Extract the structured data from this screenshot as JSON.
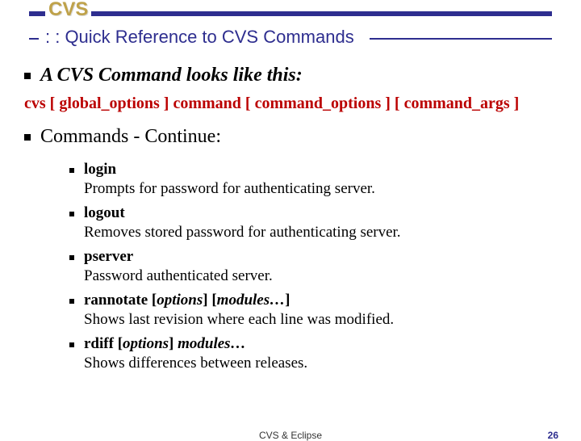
{
  "title": "CVS",
  "subtitle": ": : Quick Reference to CVS Commands",
  "section1_heading": "A CVS Command looks like this:",
  "syntax_line": "cvs [ global_options ] command [ command_options ] [ command_args ]",
  "section2_heading": "Commands - Continue:",
  "commands": [
    {
      "cmd": "login",
      "args_plain": "",
      "args_italic": "",
      "desc": "Prompts for password for authenticating server."
    },
    {
      "cmd": "logout",
      "args_plain": "",
      "args_italic": "",
      "desc": "Removes stored password for authenticating server."
    },
    {
      "cmd": "pserver",
      "args_plain": "",
      "args_italic": "",
      "desc": "Password authenticated server."
    },
    {
      "cmd": "rannotate",
      "args_plain": " [",
      "args_italic": "options",
      "args_plain2": "] [",
      "args_italic2": "modules…",
      "args_plain3": "]",
      "desc": "Shows last revision where each line was modified."
    },
    {
      "cmd": "rdiff",
      "args_plain": " [",
      "args_italic": "options",
      "args_plain2": "] ",
      "args_italic2": "modules…",
      "args_plain3": "",
      "desc": "Shows differences between releases."
    }
  ],
  "footer_center": "CVS & Eclipse",
  "footer_page": "26"
}
